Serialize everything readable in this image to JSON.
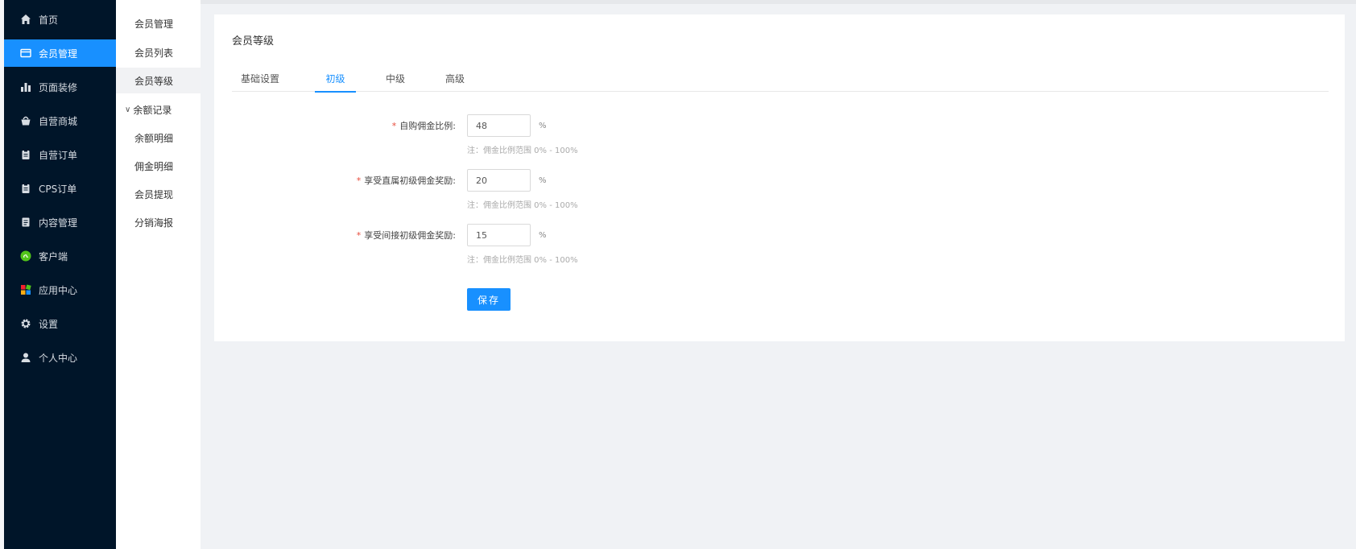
{
  "sidebar": {
    "items": [
      {
        "label": "首页",
        "icon": "home-icon"
      },
      {
        "label": "会员管理",
        "icon": "member-card-icon",
        "active": true
      },
      {
        "label": "页面装修",
        "icon": "bar-chart-icon"
      },
      {
        "label": "自营商城",
        "icon": "shopping-basket-icon"
      },
      {
        "label": "自营订单",
        "icon": "clipboard-icon"
      },
      {
        "label": "CPS订单",
        "icon": "clipboard-icon"
      },
      {
        "label": "内容管理",
        "icon": "document-icon"
      },
      {
        "label": "客户端",
        "icon": "mini-program-icon"
      },
      {
        "label": "应用中心",
        "icon": "app-grid-icon"
      },
      {
        "label": "设置",
        "icon": "gear-icon"
      },
      {
        "label": "个人中心",
        "icon": "user-icon"
      }
    ],
    "accent": "#1890ff",
    "background": "#001529"
  },
  "subnav": {
    "items": [
      {
        "label": "会员管理"
      },
      {
        "label": "会员列表"
      },
      {
        "label": "会员等级",
        "active": true
      },
      {
        "label": "余额记录",
        "group": true,
        "chevron": "∨"
      },
      {
        "label": "余额明细"
      },
      {
        "label": "佣金明细"
      },
      {
        "label": "会员提现"
      },
      {
        "label": "分销海报"
      }
    ]
  },
  "card": {
    "title": "会员等级",
    "tabs": [
      {
        "label": "基础设置"
      },
      {
        "label": "初级",
        "active": true
      },
      {
        "label": "中级"
      },
      {
        "label": "高级"
      }
    ],
    "fields": [
      {
        "required": "*",
        "label": "自购佣金比例:",
        "value": "48",
        "unit": "%",
        "note": "注：佣金比例范围 0% - 100%"
      },
      {
        "required": "*",
        "label": "享受直属初级佣金奖励:",
        "value": "20",
        "unit": "%",
        "note": "注：佣金比例范围 0% - 100%"
      },
      {
        "required": "*",
        "label": "享受间接初级佣金奖励:",
        "value": "15",
        "unit": "%",
        "note": "注：佣金比例范围 0% - 100%"
      }
    ],
    "save_label": "保存"
  }
}
